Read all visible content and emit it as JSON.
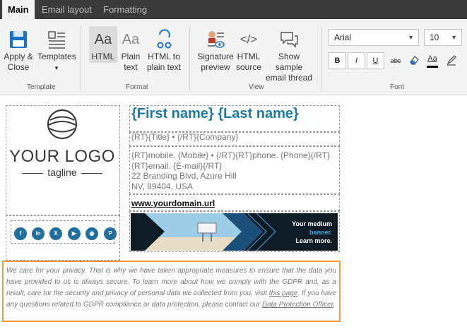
{
  "tabs": [
    {
      "label": "Main",
      "active": true
    },
    {
      "label": "Email layout",
      "active": false
    },
    {
      "label": "Formatting",
      "active": false
    }
  ],
  "ribbon": {
    "template_group": {
      "label": "Template",
      "apply_close_line1": "Apply &",
      "apply_close_line2": "Close",
      "templates": "Templates"
    },
    "format_group": {
      "label": "Format",
      "html": "HTML",
      "plain_line1": "Plain",
      "plain_line2": "text",
      "html_to_plain_line1": "HTML to",
      "html_to_plain_line2": "plain text"
    },
    "view_group": {
      "label": "View",
      "sig_preview_line1": "Signature",
      "sig_preview_line2": "preview",
      "html_source_line1": "HTML",
      "html_source_line2": "source",
      "show_thread_line1": "Show sample",
      "show_thread_line2": "email thread"
    },
    "font_group": {
      "label": "Font",
      "font_name": "Arial",
      "font_size": "10",
      "bold": "B",
      "italic": "I",
      "underline": "U",
      "strikethrough": "abc"
    },
    "colors": {
      "accent": "#0078d4",
      "font_color_bar": "#000000"
    }
  },
  "signature": {
    "logo_main": "YOUR LOGO",
    "logo_tagline": "tagline",
    "name": "{First name} {Last name}",
    "title_line": "{RT}{Title} • {/RT}{Company}",
    "contact_line1": "{RT}mobile. {Mobile} • {/RT}{RT}phone. {Phone}{/RT}",
    "contact_line2": "{RT}email. {E-mail}{/RT}",
    "address_line1": "22 Branding Blvd, Azure Hill",
    "address_line2": "NV, 89404, USA",
    "domain": "www.yourdomain.url",
    "banner_line1": "Your medium",
    "banner_line2": "banner.",
    "banner_line3": "Learn more.",
    "social_icons": [
      "facebook-icon",
      "linkedin-icon",
      "x-icon",
      "youtube-icon",
      "instagram-icon",
      "pinterest-icon"
    ],
    "name_color": "#1c7aa6",
    "social_color": "#1f6fa0"
  },
  "gdpr": {
    "part1": "We care for your privacy. That is why we have taken appropriate measures to ensure that the data you have provided to us is always secure. To learn more about how we comply with the GDPR and, as a result, care for the security and privacy of personal data we collected from you, visit ",
    "link1": "this page",
    "part2": ". If you have any questions related to GDPR compliance or data protection, please contact our ",
    "link2": "Data Protection Officer",
    "part3": ".",
    "border_color": "#f29b38"
  }
}
